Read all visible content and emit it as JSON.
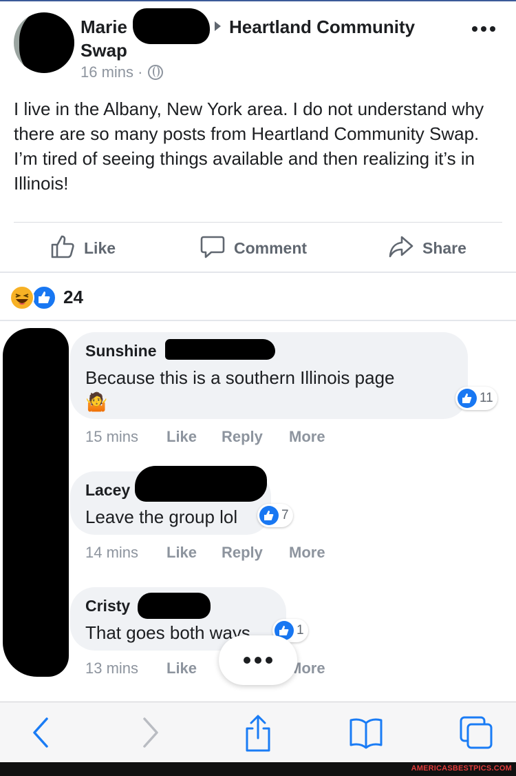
{
  "post": {
    "author_first": "Marie",
    "author_last": "Swap",
    "group": "Heartland Community",
    "time": "16 mins ·",
    "text": "I live in the Albany, New York area. I do not understand why there are so many posts from Heartland Community Swap. I’m tired of seeing things available and then realizing it’s in Illinois!"
  },
  "actions": {
    "like": "Like",
    "comment": "Comment",
    "share": "Share"
  },
  "reactions": {
    "count": "24"
  },
  "comments": [
    {
      "name": "Sunshine",
      "text": "Because this is a southern Illinois page",
      "emoji": "🤷",
      "likes": "11",
      "time": "15 mins",
      "like": "Like",
      "reply": "Reply",
      "more": "More"
    },
    {
      "name": "Lacey",
      "text": "Leave the group lol",
      "likes": "7",
      "time": "14 mins",
      "like": "Like",
      "reply": "Reply",
      "more": "More"
    },
    {
      "name": "Cristy",
      "text": "That goes both ways",
      "likes": "1",
      "time": "13 mins",
      "like": "Like",
      "more": "More"
    }
  ],
  "watermark": "AMERICASBESTPICS.COM",
  "colors": {
    "facebook_blue": "#1877f2",
    "ios_blue": "#1a7cf5",
    "gray_text": "#8d949e"
  }
}
